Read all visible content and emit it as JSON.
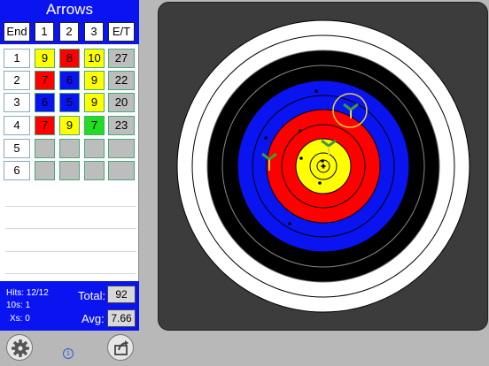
{
  "panel": {
    "title": "Arrows",
    "headers": [
      "End",
      "1",
      "2",
      "3",
      "E/T"
    ]
  },
  "ends": [
    {
      "end": "1",
      "arrows": [
        "9",
        "8",
        "10"
      ],
      "colors": [
        "#ffff00",
        "#ff0000",
        "#ffff00"
      ],
      "total": "27"
    },
    {
      "end": "2",
      "arrows": [
        "7",
        "6",
        "9"
      ],
      "colors": [
        "#ff0000",
        "#0a14f0",
        "#ffff00"
      ],
      "total": "22"
    },
    {
      "end": "3",
      "arrows": [
        "6",
        "5",
        "9"
      ],
      "colors": [
        "#0a14f0",
        "#0a14f0",
        "#ffff00"
      ],
      "total": "20"
    },
    {
      "end": "4",
      "arrows": [
        "7",
        "9",
        "7"
      ],
      "colors": [
        "#ff0000",
        "#ffff00",
        "#22dd22"
      ],
      "total": "23"
    },
    {
      "end": "5",
      "arrows": [
        "",
        "",
        ""
      ],
      "colors": [
        "#bdbdbd",
        "#bdbdbd",
        "#bdbdbd"
      ],
      "total": ""
    },
    {
      "end": "6",
      "arrows": [
        "",
        "",
        ""
      ],
      "colors": [
        "#bdbdbd",
        "#bdbdbd",
        "#bdbdbd"
      ],
      "total": ""
    }
  ],
  "stats": {
    "hits": "Hits: 12/12",
    "tens": "10s:  1",
    "xs": "Xs:  0",
    "total_label": "Total:",
    "total_value": "92",
    "avg_label": "Avg:",
    "avg_value": "7.66"
  },
  "toolbar": {
    "settings_icon": "gear-icon",
    "info_label": "i",
    "share_icon": "share-icon"
  },
  "target": {
    "colors": {
      "white": "#ffffff",
      "black": "#000000",
      "blue": "#0a14f0",
      "red": "#ff0000",
      "yellow": "#ffff00",
      "board": "#3c3c3c"
    }
  }
}
